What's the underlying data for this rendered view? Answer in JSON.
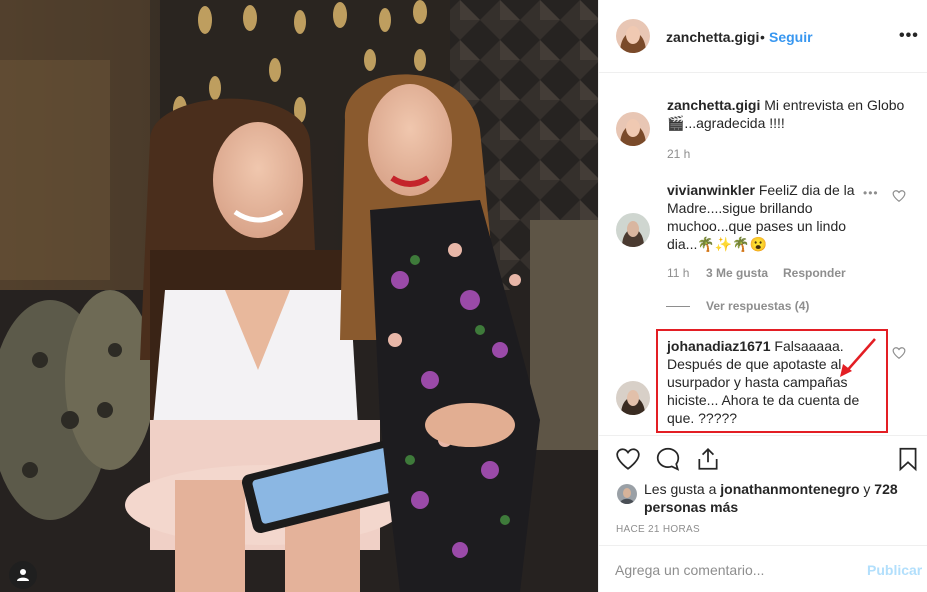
{
  "post": {
    "username": "zanchetta.gigi",
    "dot": "•",
    "follow_label": "Seguir",
    "more_label": "•••",
    "caption_user": "zanchetta.gigi",
    "caption_text": "Mi entrevista en Globo 🎬...agradecida !!!!",
    "caption_time": "21 h"
  },
  "comments": [
    {
      "user": "vivianwinkler",
      "text": "FeeliZ dia de la Madre....sigue brillando muchoo...que pases un lindo dia...🌴✨🌴😮",
      "time": "11 h",
      "likes": "3 Me gusta",
      "reply_label": "Responder",
      "view_replies": "Ver respuestas (4)"
    },
    {
      "user": "johanadiaz1671",
      "text": "Falsaaaaa. Después de que apotaste al usurpador y hasta campañas hiciste... Ahora te da cuenta de que. ?????"
    }
  ],
  "likes": {
    "prefix": "Les gusta a",
    "user": "jonathanmontenegro",
    "connector": "y",
    "count": "728 personas más"
  },
  "time_ago": "HACE 21 HORAS",
  "add_comment": {
    "placeholder": "Agrega un comentario...",
    "publish_label": "Publicar"
  },
  "icons": [
    "user-tag-icon",
    "more-options-icon",
    "heart-icon",
    "comment-icon",
    "share-icon",
    "bookmark-icon"
  ],
  "colors": {
    "accent": "#3897f0",
    "highlight_border": "#e31e24",
    "muted": "#8e8e8e",
    "publish_disabled": "#b2dffc"
  }
}
